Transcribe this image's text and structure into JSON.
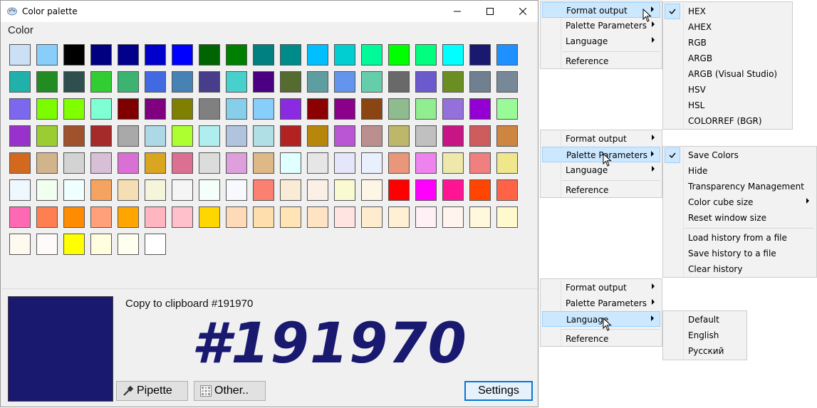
{
  "window": {
    "title": "Color palette",
    "icon": "palette-icon",
    "color_label": "Color",
    "copy_text": "Copy to clipboard #191970",
    "big_hex": "#191970",
    "selected_color": "#191970",
    "buttons": {
      "pipette": "Pipette",
      "other": "Other..",
      "settings": "Settings"
    }
  },
  "palette": [
    "#cce0f5",
    "#87cefa",
    "#000000",
    "#000080",
    "#00008b",
    "#0000cd",
    "#0000ff",
    "#006400",
    "#008000",
    "#008080",
    "#008b8b",
    "#00bfff",
    "#00ced1",
    "#00fa9a",
    "#00ff00",
    "#00ff7f",
    "#00ffff",
    "#191970",
    "#1e90ff",
    "#20b2aa",
    "#228b22",
    "#2f4f4f",
    "#32cd32",
    "#3cb371",
    "#4169e1",
    "#4682b4",
    "#483d8b",
    "#48d1cc",
    "#4b0082",
    "#556b2f",
    "#5f9ea0",
    "#6495ed",
    "#66cdaa",
    "#696969",
    "#6a5acd",
    "#6b8e23",
    "#708090",
    "#778899",
    "#7b68ee",
    "#7cfc00",
    "#7fff00",
    "#7fffd4",
    "#800000",
    "#800080",
    "#808000",
    "#808080",
    "#87ceeb",
    "#87cefa",
    "#8a2be2",
    "#8b0000",
    "#8b008b",
    "#8b4513",
    "#8fbc8f",
    "#90ee90",
    "#9370db",
    "#9400d3",
    "#98fb98",
    "#9932cc",
    "#9acd32",
    "#a0522d",
    "#a52a2a",
    "#a9a9a9",
    "#add8e6",
    "#adff2f",
    "#afeeee",
    "#b0c4de",
    "#b0e0e6",
    "#b22222",
    "#b8860b",
    "#ba55d3",
    "#bc8f8f",
    "#bdb76b",
    "#c0c0c0",
    "#c71585",
    "#cd5c5c",
    "#cd853f",
    "#d2691e",
    "#d2b48c",
    "#d3d3d3",
    "#d8bfd8",
    "#da70d6",
    "#daa520",
    "#db7093",
    "#dcdcdc",
    "#dda0dd",
    "#deb887",
    "#e0ffff",
    "#e6e6e6",
    "#e6e6fa",
    "#e8f0fe",
    "#e9967a",
    "#ee82ee",
    "#eee8aa",
    "#f08080",
    "#f0e68c",
    "#f0f8ff",
    "#f0fff0",
    "#f0ffff",
    "#f4a460",
    "#f5deb3",
    "#f5f5dc",
    "#f5f5f5",
    "#f5fffa",
    "#f8f8ff",
    "#fa8072",
    "#faebd7",
    "#faf0e6",
    "#fafad2",
    "#fdf5e6",
    "#ff0000",
    "#ff00ff",
    "#ff1493",
    "#ff4500",
    "#ff6347",
    "#ff69b4",
    "#ff7f50",
    "#ff8c00",
    "#ffa07a",
    "#ffa500",
    "#ffb6c1",
    "#ffc0cb",
    "#ffd700",
    "#ffdab9",
    "#ffdead",
    "#ffe4b5",
    "#ffe4c4",
    "#ffe4e1",
    "#ffebcd",
    "#ffefd5",
    "#fff0f5",
    "#fff5ee",
    "#fff8dc",
    "#fffacd",
    "#fffaf0",
    "#fffafa",
    "#ffff00",
    "#ffffe0",
    "#fffff0",
    "#ffffff"
  ],
  "menu_main": [
    "Format output",
    "Palette Parameters",
    "Language",
    "Reference"
  ],
  "format_menu": [
    "HEX",
    "AHEX",
    "RGB",
    "ARGB",
    "ARGB (Visual Studio)",
    "HSV",
    "HSL",
    "COLORREF (BGR)"
  ],
  "palette_params_menu": [
    "Save Colors",
    "Hide",
    "Transparency Management",
    "Color cube size",
    "Reset window size",
    "Load history from a file",
    "Save history to a file",
    "Clear history"
  ],
  "language_menu": [
    "Default",
    "English",
    "Русский"
  ],
  "colors": {
    "highlight": "#cce8ff",
    "highlight_border": "#99d1ff",
    "big_hex": "#191970",
    "settings_border": "#0078d7"
  }
}
